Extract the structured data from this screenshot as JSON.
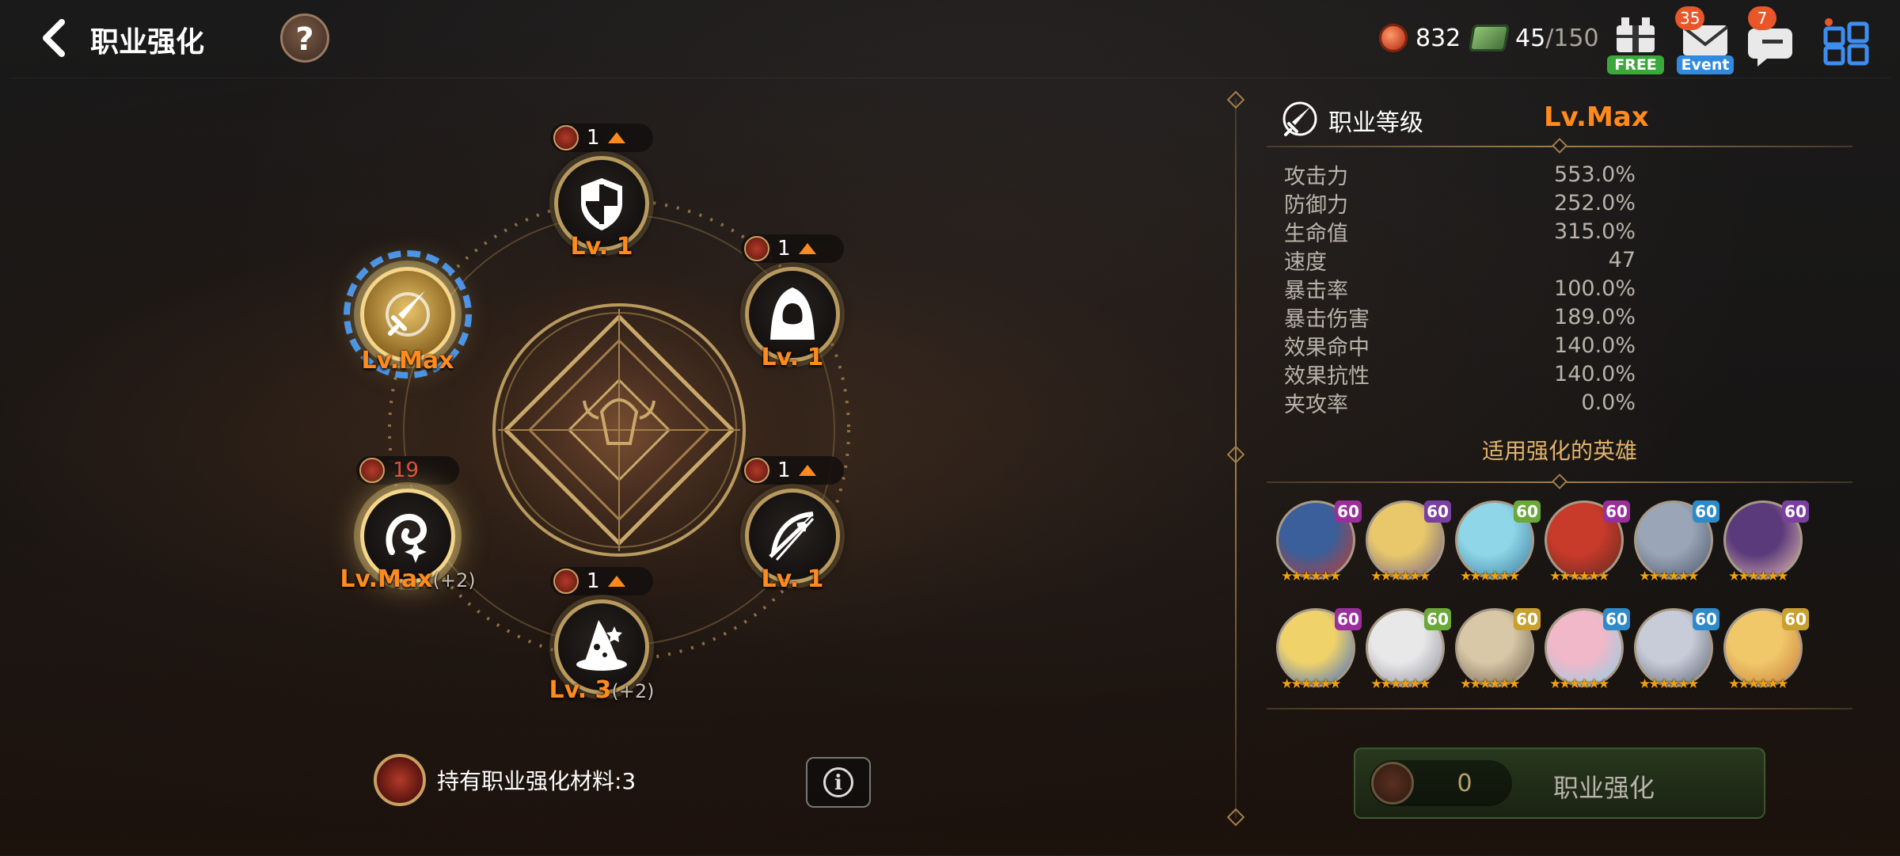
{
  "header": {
    "title": "职业强化",
    "help_label": "?"
  },
  "currency": {
    "coins": "832",
    "stamina_current": "45",
    "stamina_max": "/150"
  },
  "top_icons": {
    "shop_ribbon": "FREE",
    "mail_ribbon": "Event",
    "mail_badge": "35",
    "chat_badge": "7"
  },
  "nodes": [
    {
      "id": "defender",
      "level": "Lv. 1",
      "bonus": "",
      "cost": "1",
      "icon": "shield-icon"
    },
    {
      "id": "assassin",
      "level": "Lv. 1",
      "bonus": "",
      "cost": "1",
      "icon": "hood-icon"
    },
    {
      "id": "ranger",
      "level": "Lv. 1",
      "bonus": "",
      "cost": "1",
      "icon": "bow-icon"
    },
    {
      "id": "mage",
      "level": "Lv. 3",
      "bonus": "(+2)",
      "cost": "1",
      "icon": "wizard-hat-icon"
    },
    {
      "id": "healer",
      "level": "Lv.Max",
      "bonus": "(+2)",
      "cost": "19",
      "icon": "healer-icon"
    },
    {
      "id": "warrior",
      "level": "Lv.Max",
      "bonus": "",
      "cost": "",
      "icon": "sword-icon"
    }
  ],
  "material": {
    "label": "持有职业强化材料:3",
    "info_label": "i"
  },
  "panel": {
    "class_label": "职业等级",
    "class_level": "Lv.Max",
    "stats": [
      {
        "name": "攻击力",
        "value": "553.0%"
      },
      {
        "name": "防御力",
        "value": "252.0%"
      },
      {
        "name": "生命值",
        "value": "315.0%"
      },
      {
        "name": "速度",
        "value": "47"
      },
      {
        "name": "暴击率",
        "value": "100.0%"
      },
      {
        "name": "暴击伤害",
        "value": "189.0%"
      },
      {
        "name": "效果命中",
        "value": "140.0%"
      },
      {
        "name": "效果抗性",
        "value": "140.0%"
      },
      {
        "name": "夹攻率",
        "value": "0.0%"
      }
    ],
    "heroes_title": "适用强化的英雄",
    "heroes": [
      {
        "level": "60",
        "badge_color": "#9a2f9c",
        "face": [
          "#3a5f9a",
          "#c83a2a"
        ]
      },
      {
        "level": "60",
        "badge_color": "#7a3fa0",
        "face": [
          "#e8c86a",
          "#6a5a8a"
        ]
      },
      {
        "level": "60",
        "badge_color": "#6aa83a",
        "face": [
          "#8fd6e8",
          "#3a7a9a"
        ]
      },
      {
        "level": "60",
        "badge_color": "#9a2f9c",
        "face": [
          "#c83a2a",
          "#5a2a20"
        ]
      },
      {
        "level": "60",
        "badge_color": "#2f8ac8",
        "face": [
          "#9aa6b8",
          "#4a5668"
        ]
      },
      {
        "level": "60",
        "badge_color": "#7a3fa0",
        "face": [
          "#5a3a7a",
          "#e8c0b0"
        ]
      },
      {
        "level": "60",
        "badge_color": "#9a2f9c",
        "face": [
          "#f0d26a",
          "#3a6ac8"
        ]
      },
      {
        "level": "60",
        "badge_color": "#6aa83a",
        "face": [
          "#e8e8e8",
          "#8a8a98"
        ]
      },
      {
        "level": "60",
        "badge_color": "#c8a02f",
        "face": [
          "#d8c8a8",
          "#6a5a48"
        ]
      },
      {
        "level": "60",
        "badge_color": "#2f8ac8",
        "face": [
          "#f0b8c8",
          "#8ad0e8"
        ]
      },
      {
        "level": "60",
        "badge_color": "#2f8ac8",
        "face": [
          "#c8ccd8",
          "#5a6070"
        ]
      },
      {
        "level": "60",
        "badge_color": "#c8a02f",
        "face": [
          "#f0c86a",
          "#c87a3a"
        ]
      }
    ],
    "upgrade_qty": "0",
    "upgrade_label": "职业强化"
  },
  "colors": {
    "accent_orange": "#ff8a1e",
    "gold": "#a27e4a",
    "selection_blue": "#3d8ef0"
  }
}
